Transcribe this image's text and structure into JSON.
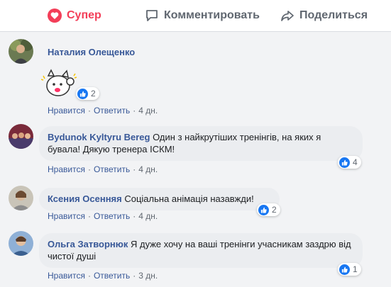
{
  "actions": {
    "like": "Супер",
    "comment": "Комментировать",
    "share": "Поделиться"
  },
  "colors": {
    "like_accent": "#f33e58",
    "link_blue": "#385898",
    "react_blue": "#1877f2"
  },
  "comments": [
    {
      "author": "Наталия Олещенко",
      "text": "",
      "sticker": "waving-cat-sticker",
      "reactions": "2",
      "meta": {
        "like": "Нравится",
        "reply": "Ответить",
        "time": "4 дн."
      }
    },
    {
      "author": "Bydunok Kyltyru Bereg",
      "text": "Один з найкрутіших тренінгів, на яких я бувала! Дякую тренера ІСКМ!",
      "reactions": "4",
      "meta": {
        "like": "Нравится",
        "reply": "Ответить",
        "time": "4 дн."
      }
    },
    {
      "author": "Ксения Осенняя",
      "text": "Соціальна анімація назавжди!",
      "reactions": "2",
      "meta": {
        "like": "Нравится",
        "reply": "Ответить",
        "time": "4 дн."
      }
    },
    {
      "author": "Ольга Затворнюк",
      "text": "Я дуже хочу на ваші тренінги учасникам заздрю від чистої душі",
      "reactions": "1",
      "meta": {
        "like": "Нравится",
        "reply": "Ответить",
        "time": "3 дн."
      }
    }
  ]
}
